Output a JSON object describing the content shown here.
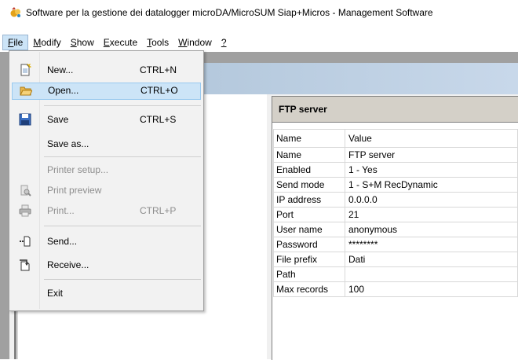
{
  "window": {
    "title": "Software per la gestione dei datalogger microDA/MicroSUM Siap+Micros - Management Software"
  },
  "menubar": {
    "items": [
      {
        "label": "File",
        "ul": "F",
        "rest": "ile"
      },
      {
        "label": "Modify",
        "ul": "M",
        "rest": "odify"
      },
      {
        "label": "Show",
        "ul": "S",
        "rest": "how"
      },
      {
        "label": "Execute",
        "ul": "E",
        "rest": "xecute"
      },
      {
        "label": "Tools",
        "ul": "T",
        "rest": "ools"
      },
      {
        "label": "Window",
        "ul": "W",
        "rest": "indow"
      },
      {
        "label": "?",
        "ul": "?",
        "rest": ""
      }
    ]
  },
  "file_menu": {
    "items": [
      {
        "label": "New...",
        "shortcut": "CTRL+N",
        "icon": "new-file-icon",
        "enabled": true
      },
      {
        "label": "Open...",
        "shortcut": "CTRL+O",
        "icon": "folder-open-icon",
        "enabled": true,
        "highlighted": true
      },
      {
        "label": "Save",
        "shortcut": "CTRL+S",
        "icon": "save-icon",
        "enabled": true
      },
      {
        "label": "Save as...",
        "shortcut": "",
        "icon": "",
        "enabled": true
      },
      {
        "label": "Printer setup...",
        "shortcut": "",
        "icon": "",
        "enabled": false
      },
      {
        "label": "Print preview",
        "shortcut": "",
        "icon": "print-preview-icon",
        "enabled": false
      },
      {
        "label": "Print...",
        "shortcut": "CTRL+P",
        "icon": "printer-icon",
        "enabled": false
      },
      {
        "label": "Send...",
        "shortcut": "",
        "icon": "send-icon",
        "enabled": true
      },
      {
        "label": "Receive...",
        "shortcut": "",
        "icon": "receive-icon",
        "enabled": true
      },
      {
        "label": "Exit",
        "shortcut": "",
        "icon": "",
        "enabled": true
      }
    ]
  },
  "panel": {
    "title": "FTP server",
    "headers": {
      "name": "Name",
      "value": "Value"
    },
    "rows": [
      {
        "name": "Name",
        "value": "FTP server"
      },
      {
        "name": "Enabled",
        "value": "1 - Yes"
      },
      {
        "name": "Send mode",
        "value": "1 - S+M RecDynamic"
      },
      {
        "name": "IP address",
        "value": "0.0.0.0"
      },
      {
        "name": "Port",
        "value": "21"
      },
      {
        "name": "User name",
        "value": "anonymous"
      },
      {
        "name": "Password",
        "value": "********"
      },
      {
        "name": "File prefix",
        "value": "Dati"
      },
      {
        "name": "Path",
        "value": ""
      },
      {
        "name": "Max records",
        "value": "100"
      }
    ]
  },
  "colors": {
    "menu_highlight": "#cce4f7",
    "child_title_gradient": "#9fb7d2",
    "disabled_text": "#8d8d8d"
  }
}
